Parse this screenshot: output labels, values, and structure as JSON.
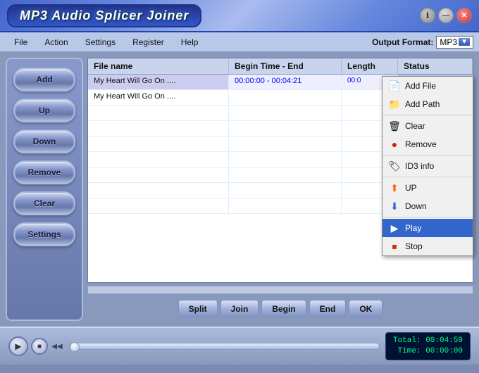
{
  "app": {
    "title": "MP3 Audio Splicer Joiner"
  },
  "window_controls": {
    "info": "ℹ",
    "minimize": "—",
    "close": "✕"
  },
  "menu": {
    "items": [
      "File",
      "Action",
      "Settings",
      "Register",
      "Help"
    ],
    "output_format_label": "Output Format:",
    "output_format_value": "MP3"
  },
  "sidebar": {
    "buttons": [
      "Add",
      "Up",
      "Down",
      "Remove",
      "Clear",
      "Settings"
    ]
  },
  "table": {
    "headers": [
      "File name",
      "Begin Time - End",
      "Length",
      "Status"
    ],
    "rows": [
      {
        "filename": "My Heart Will Go On ....",
        "time": "00:00:00 - 00:04:21",
        "length": "00:0",
        "status": ""
      },
      {
        "filename": "My Heart Will Go On ....",
        "time": "",
        "length": "",
        "status": ""
      }
    ]
  },
  "context_menu": {
    "items": [
      {
        "label": "Add File",
        "icon": "📄"
      },
      {
        "label": "Add Path",
        "icon": "📁"
      },
      {
        "label": "Clear",
        "icon": "🗑"
      },
      {
        "label": "Remove",
        "icon": "❌"
      },
      {
        "label": "ID3 info",
        "icon": "🏷"
      },
      {
        "label": "UP",
        "icon": "⬆"
      },
      {
        "label": "Down",
        "icon": "⬇"
      },
      {
        "label": "Play",
        "icon": "▶",
        "active": true
      },
      {
        "label": "Stop",
        "icon": "⏹"
      }
    ]
  },
  "bottom_buttons": [
    "Split",
    "Join",
    "Begin",
    "End",
    "OK"
  ],
  "player": {
    "total_label": "Total:",
    "total_time": "00:04:59",
    "time_label": "Time:",
    "current_time": "00:00:00"
  }
}
